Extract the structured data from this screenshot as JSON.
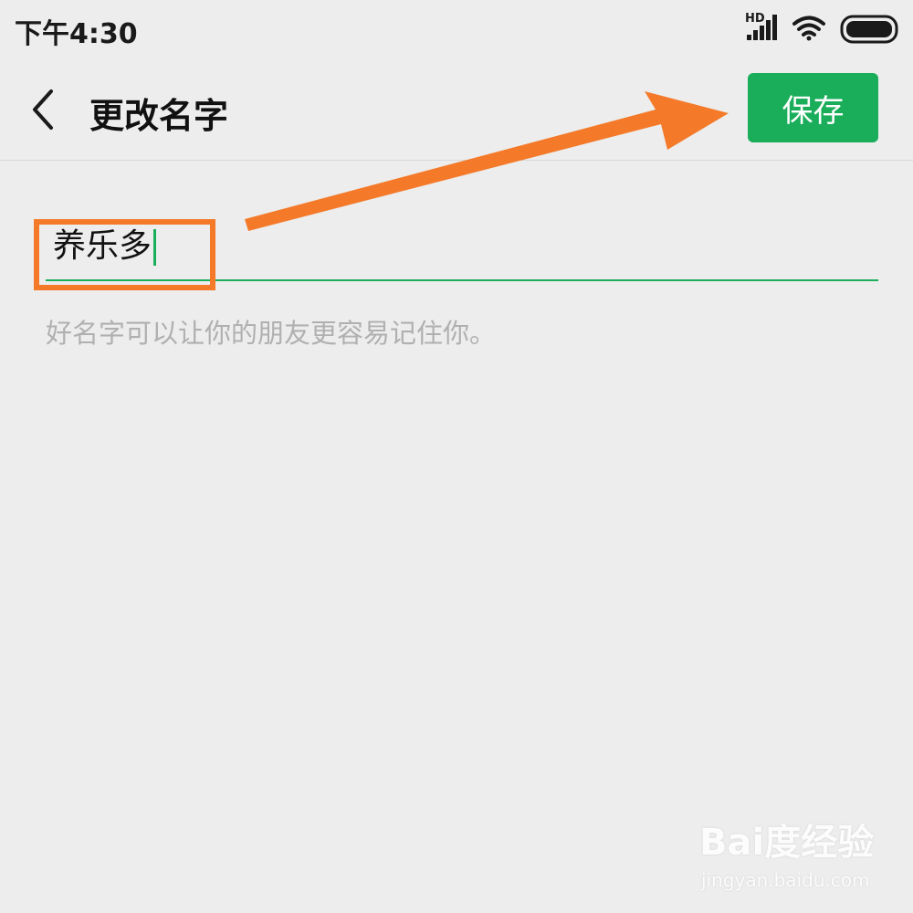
{
  "status_bar": {
    "time": "下午4:30",
    "network_label": "HD",
    "icons": [
      "signal-icon",
      "wifi-icon",
      "battery-icon"
    ]
  },
  "nav": {
    "back_icon": "chevron-left-icon",
    "title": "更改名字",
    "save_label": "保存"
  },
  "form": {
    "name_value": "养乐多",
    "hint": "好名字可以让你的朋友更容易记住你。"
  },
  "colors": {
    "accent": "#1aad5a",
    "annotation": "#f47a2a",
    "background": "#ededed"
  },
  "watermark": {
    "logo": "Bai度经验",
    "url": "jingyan.baidu.com"
  }
}
